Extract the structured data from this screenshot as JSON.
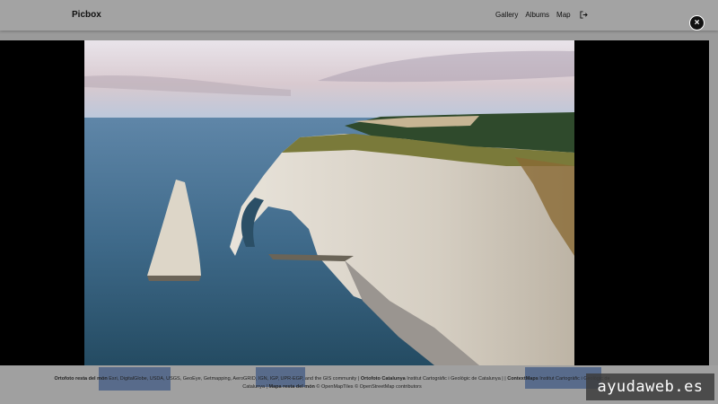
{
  "navbar": {
    "brand": "Picbox",
    "links": [
      "Gallery",
      "Albums",
      "Map"
    ],
    "logout_icon": "logout-icon"
  },
  "viewer": {
    "close_label": "×",
    "photo_description_icon": "landscape-photo"
  },
  "map_attribution": {
    "part1_title": "Ortofoto resta del món",
    "part1_text": "Esri, DigitalGlobe, USDA, USGS, GeoEye, Getmapping, AeroGRID, IGN, IGP, UPR-EGP, and the GIS community |",
    "part2_title": "Ortofoto Catalunya",
    "part2_text": "Institut Cartogràfic i Geològic de Catalunya | |",
    "part3_title": "ContextMaps",
    "part3_text": "Institut Cartogràfic i Geològic de Catalunya |",
    "part4_title": "Mapa resta del món",
    "part4_text": "© OpenMapTiles © OpenStreetMap contributors"
  },
  "watermark": "ayudaweb.es"
}
